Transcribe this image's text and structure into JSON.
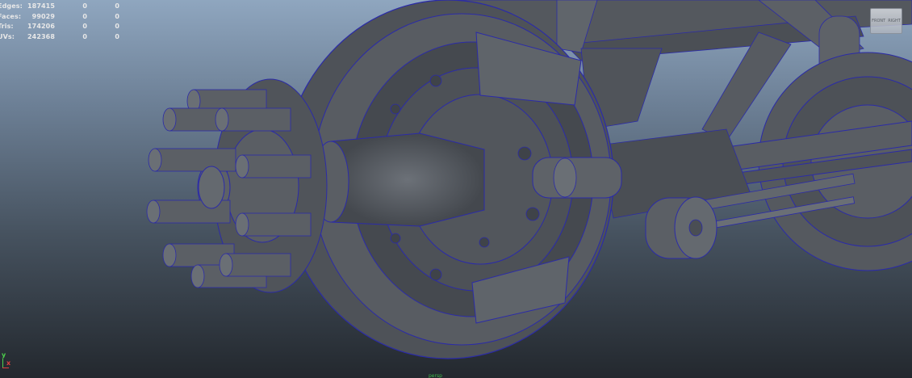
{
  "hud": {
    "rows": [
      {
        "label": "Edges:",
        "v1": "187415",
        "v2": "0",
        "v3": "0"
      },
      {
        "label": "Faces:",
        "v1": "99029",
        "v2": "0",
        "v3": "0"
      },
      {
        "label": "Tris:",
        "v1": "174206",
        "v2": "0",
        "v3": "0"
      },
      {
        "label": "UVs:",
        "v1": "242368",
        "v2": "0",
        "v3": "0"
      }
    ]
  },
  "viewcube": {
    "left_label": "FRONT",
    "right_label": "RIGHT"
  },
  "axis": {
    "y_label": "y",
    "x_label": "x"
  },
  "camera": {
    "name": "persp"
  },
  "colors": {
    "wire": "#2b2ba8",
    "mesh_fill": "#555a60",
    "mesh_dark": "#3f4349",
    "mesh_light": "#6a6f76"
  }
}
